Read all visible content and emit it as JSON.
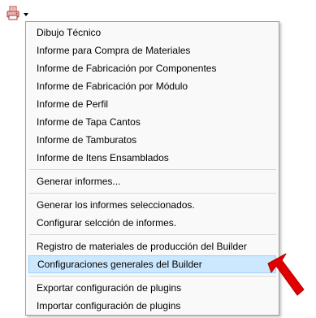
{
  "toolbar": {
    "report_button_icon": "printer-report-icon",
    "dropdown_icon": "dropdown-arrow-icon"
  },
  "menu": {
    "groups": [
      {
        "items": [
          {
            "label": "Dibujo Técnico"
          },
          {
            "label": "Informe para Compra de Materiales"
          },
          {
            "label": "Informe de Fabricación por Componentes"
          },
          {
            "label": "Informe de Fabricación por Módulo"
          },
          {
            "label": "Informe de Perfil"
          },
          {
            "label": "Informe de Tapa Cantos"
          },
          {
            "label": "Informe de Tamburatos"
          },
          {
            "label": "Informe de Itens Ensamblados"
          }
        ]
      },
      {
        "items": [
          {
            "label": "Generar informes..."
          }
        ]
      },
      {
        "items": [
          {
            "label": "Generar los informes seleccionados."
          },
          {
            "label": "Configurar selcción de informes."
          }
        ]
      },
      {
        "items": [
          {
            "label": "Registro de materiales de producción del Builder"
          },
          {
            "label": "Configuraciones generales del Builder",
            "highlighted": true
          }
        ]
      },
      {
        "items": [
          {
            "label": "Exportar configuración de plugins"
          },
          {
            "label": "Importar configuración de plugins"
          }
        ]
      }
    ]
  },
  "annotation": {
    "icon": "red-arrow-icon",
    "color": "#e00000"
  },
  "colors": {
    "highlight_bg": "#cce8ff",
    "highlight_border": "#99d1ff",
    "menu_bg": "#f9f9f9"
  }
}
